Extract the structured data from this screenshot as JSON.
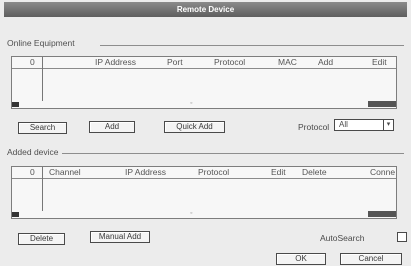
{
  "window": {
    "title": "Remote Device"
  },
  "online_section": {
    "label": "Online Equipment",
    "columns": [
      "0",
      "IP Address",
      "Port",
      "Protocol",
      "MAC",
      "Add",
      "Edit"
    ]
  },
  "buttons_top": {
    "search": "Search",
    "add": "Add",
    "quick_add": "Quick Add"
  },
  "protocol": {
    "label": "Protocol",
    "value": "All"
  },
  "added_section": {
    "label": "Added device",
    "columns": [
      "0",
      "Channel",
      "IP Address",
      "Protocol",
      "Edit",
      "Delete",
      "Conne"
    ]
  },
  "buttons_bottom": {
    "delete": "Delete",
    "manual_add": "Manual Add"
  },
  "autosearch": {
    "label": "AutoSearch",
    "checked": false
  },
  "dialog_buttons": {
    "ok": "OK",
    "cancel": "Cancel"
  }
}
